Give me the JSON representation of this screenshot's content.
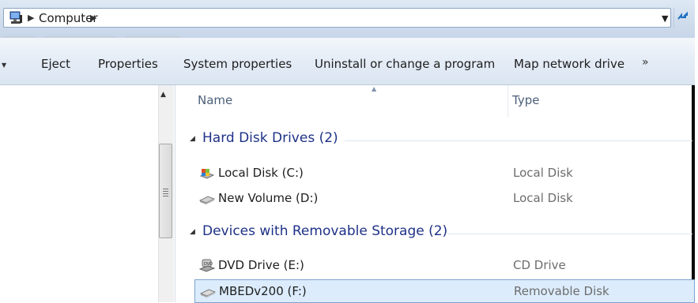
{
  "address": {
    "crumbs": [
      "Computer"
    ],
    "icon": "computer-icon"
  },
  "toolbar": {
    "items": [
      "Eject",
      "Properties",
      "System properties",
      "Uninstall or change a program",
      "Map network drive"
    ],
    "more": "»"
  },
  "columns": {
    "name": "Name",
    "type": "Type"
  },
  "groups": [
    {
      "label": "Hard Disk Drives (2)",
      "items": [
        {
          "name": "Local Disk (C:)",
          "type": "Local Disk",
          "icon": "system-drive-icon"
        },
        {
          "name": "New Volume (D:)",
          "type": "Local Disk",
          "icon": "hard-drive-icon"
        }
      ]
    },
    {
      "label": "Devices with Removable Storage (2)",
      "items": [
        {
          "name": "DVD Drive (E:)",
          "type": "CD Drive",
          "icon": "dvd-drive-icon"
        },
        {
          "name": "MBEDv200 (F:)",
          "type": "Removable Disk",
          "icon": "removable-drive-icon",
          "selected": true
        }
      ]
    }
  ],
  "colors": {
    "group_header": "#1e3287",
    "selection_bg": "#dcecfc",
    "selection_border": "#7da2ce"
  }
}
